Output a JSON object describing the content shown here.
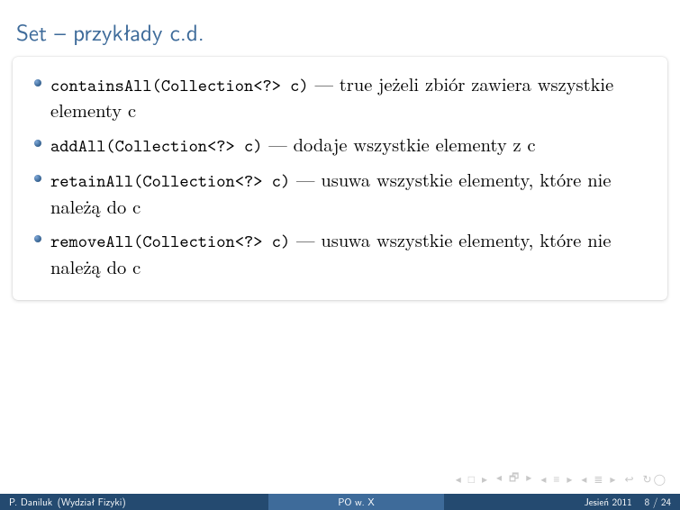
{
  "title": "Set – przykłady c.d.",
  "bullets": [
    {
      "code": "containsAll(Collection<?> c)",
      "desc": " — true jeżeli zbiór zawiera wszystkie elementy c"
    },
    {
      "code": "addAll(Collection<?> c)",
      "desc": " — dodaje wszystkie elementy z c"
    },
    {
      "code": "retainAll(Collection<?> c)",
      "desc": " — usuwa wszystkie elementy, które nie należą do c"
    },
    {
      "code": "removeAll(Collection<?> c)",
      "desc": " — usuwa wszystkie elementy, które nie należą do c"
    }
  ],
  "footer": {
    "author": "P. Daniluk",
    "institute": "(Wydział Fizyki)",
    "short_title": "PO w. X",
    "date": "Jesień 2011",
    "page_current": "8",
    "page_sep": " / ",
    "page_total": "24"
  }
}
